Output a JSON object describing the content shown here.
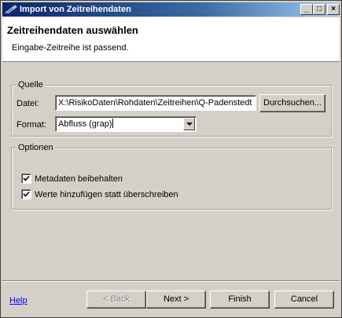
{
  "window": {
    "title": "Import von Zeitreihendaten",
    "controls": {
      "minimize": "_",
      "maximize": "□",
      "close": "×"
    }
  },
  "header": {
    "title": "Zeitreihendaten auswählen",
    "message": "Eingabe-Zeitreihe ist passend."
  },
  "quelle": {
    "label": "Quelle",
    "file_label": "Datei:",
    "file_value": "X:\\RisikoDaten\\Rohdaten\\Zeitreihen\\Q-Padenstedt",
    "browse_label": "Durchsuchen...",
    "format_label": "Format:",
    "format_value": "Abfluss (grap)"
  },
  "optionen": {
    "label": "Optionen",
    "options": [
      {
        "label": "Metadaten beibehalten",
        "checked": true
      },
      {
        "label": "Werte hinzufügen statt überschreiben",
        "checked": true
      }
    ]
  },
  "footer": {
    "help": "Help",
    "back": "< Back",
    "next": "Next >",
    "finish": "Finish",
    "cancel": "Cancel"
  },
  "icons": {
    "title": "app-icon",
    "checkmark": "checkmark-icon",
    "dropdown": "chevron-down-icon"
  }
}
